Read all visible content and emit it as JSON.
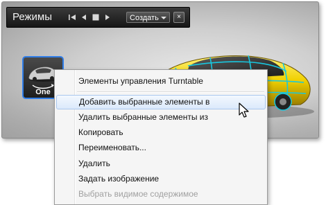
{
  "window": {
    "title": "Режимы"
  },
  "toolbar": {
    "create_label": "Создать",
    "close_glyph": "×",
    "buttons": [
      {
        "name": "first-icon"
      },
      {
        "name": "prev-icon"
      },
      {
        "name": "stop-icon"
      },
      {
        "name": "next-icon"
      }
    ]
  },
  "mode": {
    "label": "One"
  },
  "context_menu": {
    "items": [
      {
        "label": "Элементы управления Turntable"
      },
      {
        "label": "Добавить выбранные элементы в"
      },
      {
        "label": "Удалить выбранные элементы из"
      },
      {
        "label": "Копировать"
      },
      {
        "label": "Переименовать..."
      },
      {
        "label": "Удалить"
      },
      {
        "label": "Задать изображение"
      },
      {
        "label": "Выбрать видимое содержимое"
      }
    ],
    "highlighted_index": 1
  },
  "colors": {
    "accent": "#2f7de8",
    "car_body": "#f0d000",
    "wireframe": "#18c8e0",
    "menu_highlight_border": "#a9c7ee"
  }
}
